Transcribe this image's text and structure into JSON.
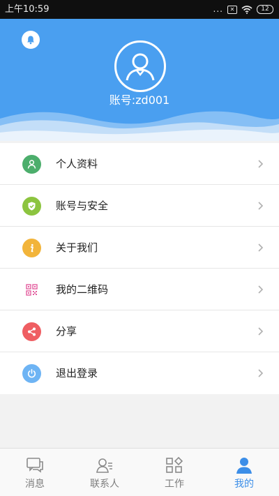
{
  "status_bar": {
    "time": "上午10:59",
    "dots": "...",
    "battery": "12"
  },
  "profile": {
    "account_text": "账号:zd001"
  },
  "colors": {
    "header_bg": "#4a9ff0",
    "icon_profile": "#4cae6c",
    "icon_security": "#8cc43f",
    "icon_about": "#f2b43a",
    "icon_qr": "#e35fa0",
    "icon_share": "#ef5e62",
    "icon_logout": "#6eb4f4",
    "tab_active": "#3c8ee8"
  },
  "menu": {
    "items": [
      {
        "label": "个人资料",
        "icon": "person-icon"
      },
      {
        "label": "账号与安全",
        "icon": "shield-check-icon"
      },
      {
        "label": "关于我们",
        "icon": "info-icon"
      },
      {
        "label": "我的二维码",
        "icon": "qr-code-icon"
      },
      {
        "label": "分享",
        "icon": "share-icon"
      },
      {
        "label": "退出登录",
        "icon": "power-icon"
      }
    ]
  },
  "tabs": [
    {
      "label": "消息",
      "icon": "chat-icon",
      "active": false
    },
    {
      "label": "联系人",
      "icon": "contacts-icon",
      "active": false
    },
    {
      "label": "工作",
      "icon": "grid-icon",
      "active": false
    },
    {
      "label": "我的",
      "icon": "user-icon",
      "active": true
    }
  ]
}
